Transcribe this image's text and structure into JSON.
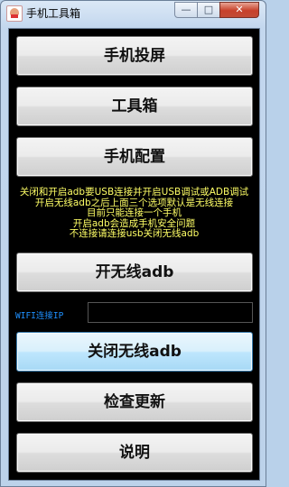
{
  "window": {
    "title": "手机工具箱",
    "minimize_glyph": "—",
    "maximize_glyph": "□",
    "close_glyph": "✕"
  },
  "buttons": {
    "screen_cast": "手机投屏",
    "toolbox": "工具箱",
    "phone_config": "手机配置",
    "enable_wireless_adb": "开无线adb",
    "disable_wireless_adb": "关闭无线adb",
    "check_update": "检查更新",
    "help": "说明"
  },
  "notice": {
    "line1": "关闭和开启adb要USB连接并开启USB调试或ADB调试",
    "line2": "开启无线adb之后上面三个选项默认是无线连接",
    "line3": "目前只能连接一个手机",
    "line4": "开启adb会造成手机安全问题",
    "line5": "不连接请连接usb关闭无线adb"
  },
  "wifi": {
    "label": "WIFI连接IP",
    "value": "",
    "placeholder": ""
  },
  "colors": {
    "notice_text": "#ffff66",
    "wifi_label": "#1e90ff",
    "client_bg": "#000000"
  }
}
